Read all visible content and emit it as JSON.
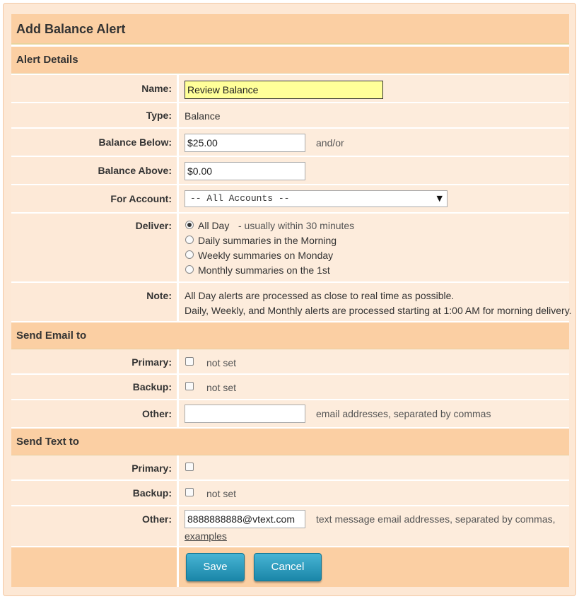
{
  "title": "Add Balance Alert",
  "sections": {
    "alert_details": "Alert Details",
    "send_email": "Send Email to",
    "send_text": "Send Text to"
  },
  "alert": {
    "name_label": "Name:",
    "name_value": "Review Balance",
    "type_label": "Type:",
    "type_value": "Balance",
    "below_label": "Balance Below:",
    "below_value": "$25.00",
    "below_hint": "and/or",
    "above_label": "Balance Above:",
    "above_value": "$0.00",
    "account_label": "For Account:",
    "account_value": "-- All Accounts --",
    "deliver_label": "Deliver:",
    "deliver_options": [
      {
        "label": "All Day",
        "selected": true
      },
      {
        "label": "Daily summaries in the Morning",
        "selected": false
      },
      {
        "label": "Weekly summaries on Monday",
        "selected": false
      },
      {
        "label": "Monthly summaries on the 1st",
        "selected": false
      }
    ],
    "deliver_hint": "- usually within 30 minutes",
    "note_label": "Note:",
    "note_line1": "All Day alerts are processed as close to real time as possible.",
    "note_line2": "Daily, Weekly, and Monthly alerts are processed starting at 1:00 AM for morning delivery."
  },
  "email": {
    "primary_label": "Primary:",
    "primary_value": "not set",
    "backup_label": "Backup:",
    "backup_value": "not set",
    "other_label": "Other:",
    "other_value": "",
    "other_hint": "email addresses, separated by commas"
  },
  "text": {
    "primary_label": "Primary:",
    "backup_label": "Backup:",
    "backup_value": "not set",
    "other_label": "Other:",
    "other_value": "8888888888@vtext.com",
    "other_hint": "text message email addresses, separated by commas,",
    "examples_link": "examples"
  },
  "buttons": {
    "save": "Save",
    "cancel": "Cancel"
  },
  "colors": {
    "header_bg": "#fbcfa3",
    "row_bg": "#fdecdc",
    "button": "#2a9bbd",
    "focused_input": "#ffff99"
  }
}
